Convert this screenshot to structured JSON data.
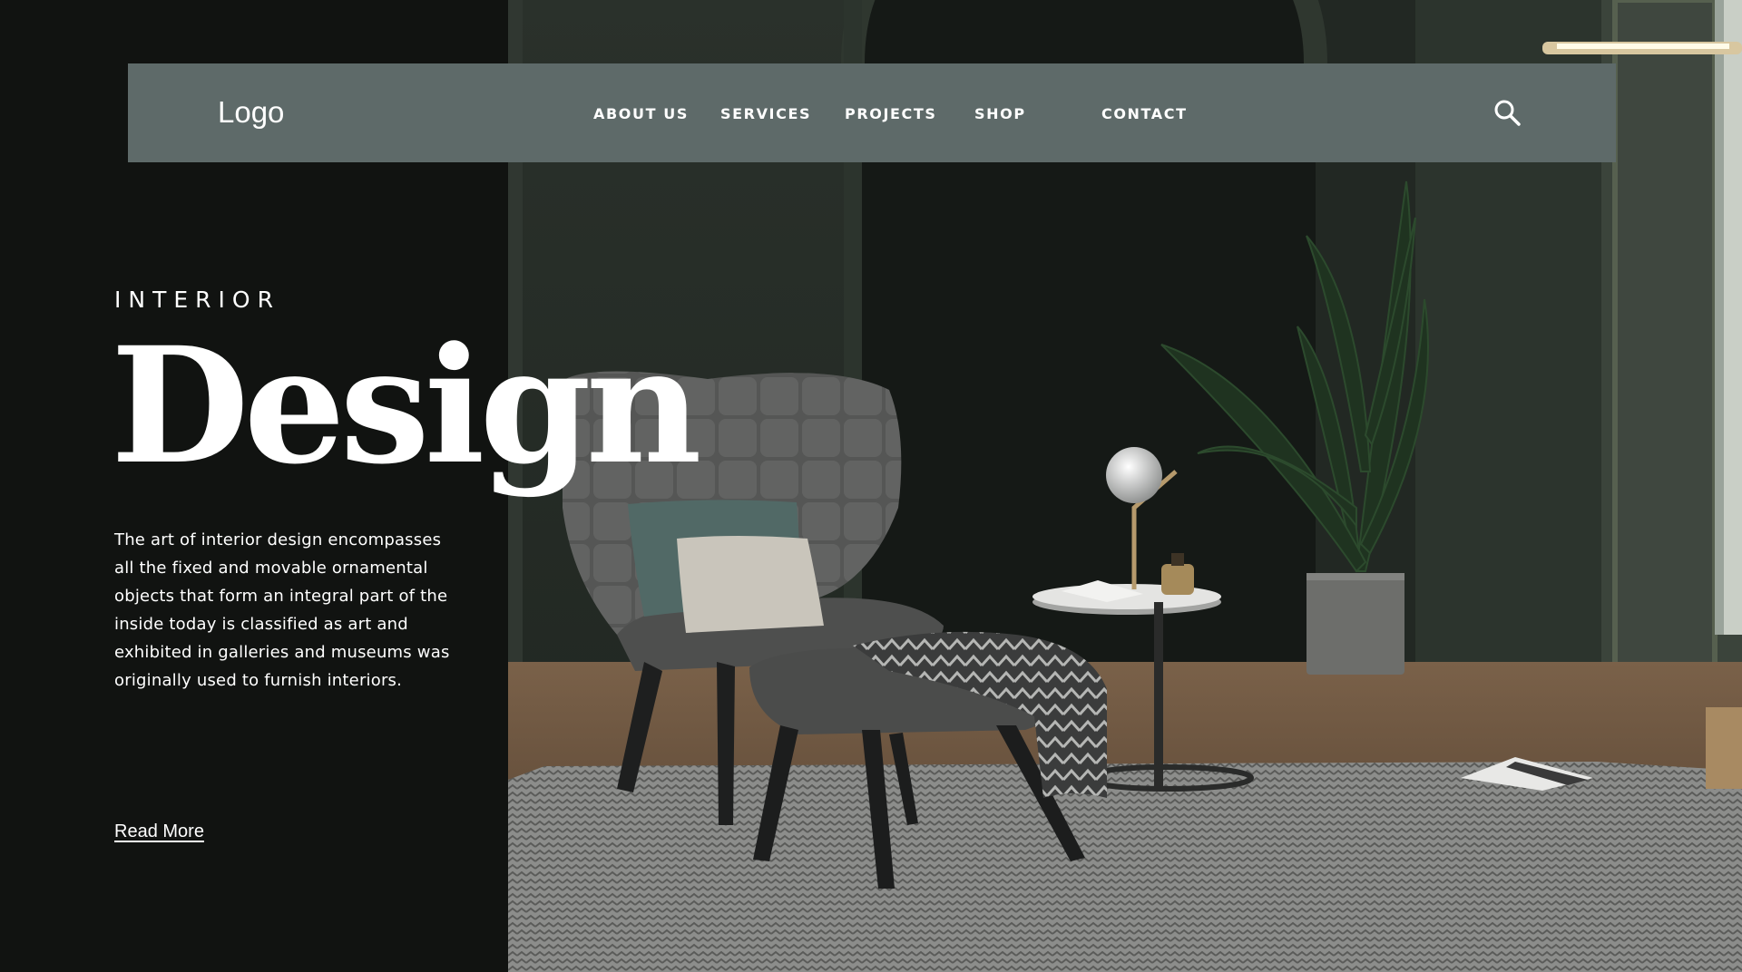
{
  "nav": {
    "logo": "Logo",
    "links": [
      "ABOUT US",
      "SERVICES",
      "PROJECTS",
      "SHOP",
      "CONTACT"
    ],
    "search_icon": "search-icon"
  },
  "hero": {
    "eyebrow": "INTERIOR",
    "title": "Design",
    "description": "The art of interior design encompasses all the fixed and movable ornamental objects that form an integral part of the inside today is classified as art and exhibited in galleries and museums was originally used to furnish interiors.",
    "cta": "Read More"
  },
  "colors": {
    "background": "#111311",
    "navbar": "#5e6a69",
    "wall": "#2b332d",
    "text": "#ffffff"
  }
}
